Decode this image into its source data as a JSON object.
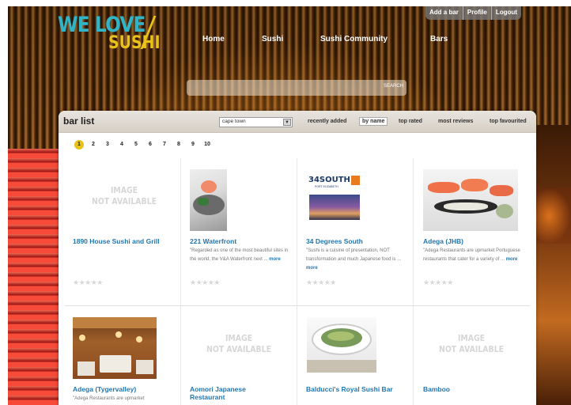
{
  "logo": {
    "line1": "WE LOVE",
    "line2": "SUSHI"
  },
  "account_links": [
    "Add a bar",
    "Profile",
    "Logout"
  ],
  "nav": [
    "Home",
    "Sushi",
    "Sushi Community",
    "Bars"
  ],
  "search": {
    "placeholder": "",
    "button": "SEARCH"
  },
  "panel": {
    "title": "bar list",
    "city": "cape town",
    "sort_tabs": [
      {
        "label": "recently added",
        "active": false
      },
      {
        "label": "by name",
        "active": true
      },
      {
        "label": "top rated",
        "active": false
      },
      {
        "label": "most reviews",
        "active": false
      },
      {
        "label": "top favourited",
        "active": false
      }
    ],
    "pages": [
      "1",
      "2",
      "3",
      "4",
      "5",
      "6",
      "7",
      "8",
      "9",
      "10"
    ],
    "current_page": 0
  },
  "na_text": [
    "IMAGE",
    "NOT AVAILABLE"
  ],
  "more_label": "more",
  "stars_display": "★★★★★",
  "bars": [
    {
      "name": "1890 House Sushi and Grill",
      "desc": "",
      "image": "none"
    },
    {
      "name": "221 Waterfront",
      "desc": "\"Regarded as one of the most beautiful sites in the world, the V&A Waterfront next ...",
      "image": "sushi-plate"
    },
    {
      "name": "34 Degrees South",
      "desc": "\"Sushi is a cuisine of presentation, NOT transformation and much Japanese food is ...",
      "image": "logo-34south",
      "logo_text": "34SOUTH",
      "logo_sub": "PORT ELIZABETH"
    },
    {
      "name": "Adega (JHB)",
      "desc": "\"Adega Restaurants are upmarket Portuguese restaurants that cater for a variety of ...",
      "image": "sushi-platter"
    },
    {
      "name": "Adega (Tygervalley)",
      "desc": "\"Adega Restaurants are upmarket",
      "image": "restaurant-interior"
    },
    {
      "name": "Aomori Japanese Restaurant",
      "desc": "",
      "image": "none"
    },
    {
      "name": "Balducci's Royal Sushi Bar",
      "desc": "",
      "image": "seaweed-bowl"
    },
    {
      "name": "Bamboo",
      "desc": "",
      "image": "none"
    }
  ]
}
